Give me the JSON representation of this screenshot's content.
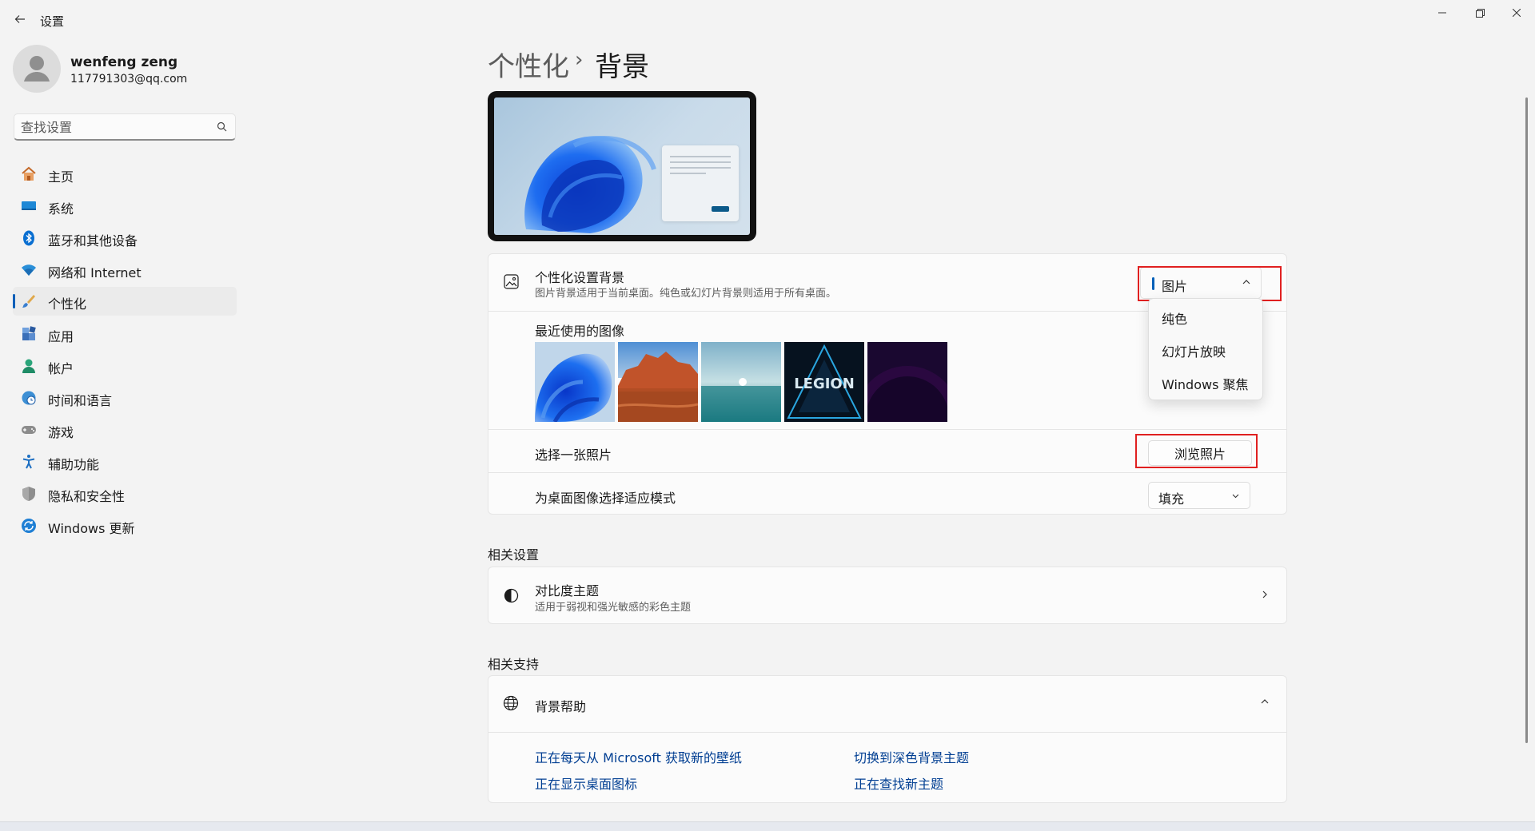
{
  "window": {
    "title": "设置"
  },
  "profile": {
    "name": "wenfeng zeng",
    "email": "117791303@qq.com"
  },
  "search": {
    "placeholder": "查找设置"
  },
  "sidebar": {
    "items": [
      {
        "label": "主页",
        "icon": "home-icon"
      },
      {
        "label": "系统",
        "icon": "system-icon"
      },
      {
        "label": "蓝牙和其他设备",
        "icon": "bluetooth-icon"
      },
      {
        "label": "网络和 Internet",
        "icon": "wifi-icon"
      },
      {
        "label": "个性化",
        "icon": "brush-icon",
        "active": true
      },
      {
        "label": "应用",
        "icon": "apps-icon"
      },
      {
        "label": "帐户",
        "icon": "account-icon"
      },
      {
        "label": "时间和语言",
        "icon": "globe-clock-icon"
      },
      {
        "label": "游戏",
        "icon": "gamepad-icon"
      },
      {
        "label": "辅助功能",
        "icon": "accessibility-icon"
      },
      {
        "label": "隐私和安全性",
        "icon": "shield-icon"
      },
      {
        "label": "Windows 更新",
        "icon": "update-icon"
      }
    ]
  },
  "breadcrumb": {
    "parent": "个性化",
    "separator": "›",
    "current": "背景"
  },
  "background_card": {
    "title": "个性化设置背景",
    "description": "图片背景适用于当前桌面。纯色或幻灯片背景则适用于所有桌面。",
    "selected": "图片",
    "options": [
      "纯色",
      "幻灯片放映",
      "Windows 聚焦"
    ],
    "recent_title": "最近使用的图像",
    "recent_images": [
      "bloom-blue",
      "red-rocks-lake",
      "calm-sea-sunrise",
      "legion-logo",
      "purple-orb"
    ],
    "legion_text": "LEGION",
    "choose_label": "选择一张照片",
    "browse_label": "浏览照片",
    "fit_label": "为桌面图像选择适应模式",
    "fit_value": "填充"
  },
  "related": {
    "title": "相关设置",
    "contrast_title": "对比度主题",
    "contrast_desc": "适用于弱视和强光敏感的彩色主题"
  },
  "support": {
    "title": "相关支持",
    "help_title": "背景帮助",
    "links": [
      "正在每天从 Microsoft 获取新的壁纸",
      "切换到深色背景主题",
      "正在显示桌面图标",
      "正在查找新主题"
    ]
  },
  "colors": {
    "accent": "#005fb8",
    "highlight": "#e02020",
    "link": "#003e92"
  }
}
